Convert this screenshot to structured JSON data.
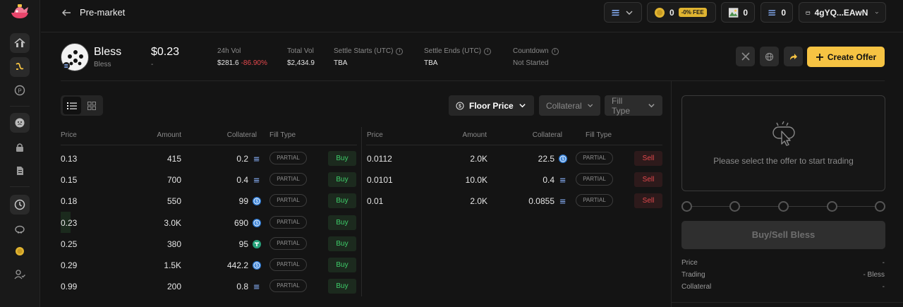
{
  "topbar": {
    "page_title": "Pre-market",
    "points": "0",
    "fee_badge": "-0% FEE",
    "image_count": "0",
    "token_count": "0",
    "wallet": "4gYQ...EAwN"
  },
  "token": {
    "name": "Bless",
    "symbol": "Bless",
    "price": "$0.23",
    "price_change": "-",
    "stats": [
      {
        "label": "24h Vol",
        "value": "$281.6",
        "change": "-86.90%",
        "info": false
      },
      {
        "label": "Total Vol",
        "value": "$2,434.9",
        "change": "",
        "info": false
      },
      {
        "label": "Settle Starts (UTC)",
        "value": "TBA",
        "change": "",
        "info": true
      },
      {
        "label": "Settle Ends (UTC)",
        "value": "TBA",
        "change": "",
        "info": true
      },
      {
        "label": "Countdown",
        "value": "Not Started",
        "change": "",
        "info": true
      }
    ],
    "create_offer_label": "Create Offer"
  },
  "filters": {
    "floor_price": "Floor Price",
    "collateral": "Collateral",
    "fill_type": "Fill Type"
  },
  "table_headers": {
    "price": "Price",
    "amount": "Amount",
    "collateral": "Collateral",
    "fill_type": "Fill Type"
  },
  "buy_orders": [
    {
      "price": "0.13",
      "amount": "415",
      "collateral": "0.2",
      "token": "sol",
      "fill": "PARTIAL",
      "action": "Buy"
    },
    {
      "price": "0.15",
      "amount": "700",
      "collateral": "0.4",
      "token": "sol",
      "fill": "PARTIAL",
      "action": "Buy"
    },
    {
      "price": "0.18",
      "amount": "550",
      "collateral": "99",
      "token": "usdc",
      "fill": "PARTIAL",
      "action": "Buy"
    },
    {
      "price": "0.23",
      "amount": "3.0K",
      "collateral": "690",
      "token": "usdc",
      "fill": "PARTIAL",
      "action": "Buy"
    },
    {
      "price": "0.25",
      "amount": "380",
      "collateral": "95",
      "token": "usdt",
      "fill": "PARTIAL",
      "action": "Buy"
    },
    {
      "price": "0.29",
      "amount": "1.5K",
      "collateral": "442.2",
      "token": "usdc",
      "fill": "PARTIAL",
      "action": "Buy"
    },
    {
      "price": "0.99",
      "amount": "200",
      "collateral": "0.8",
      "token": "sol",
      "fill": "PARTIAL",
      "action": "Buy"
    }
  ],
  "sell_orders": [
    {
      "price": "0.0112",
      "amount": "2.0K",
      "collateral": "22.5",
      "token": "usdc",
      "fill": "PARTIAL",
      "action": "Sell"
    },
    {
      "price": "0.0101",
      "amount": "10.0K",
      "collateral": "0.4",
      "token": "sol",
      "fill": "PARTIAL",
      "action": "Sell"
    },
    {
      "price": "0.01",
      "amount": "2.0K",
      "collateral": "0.0855",
      "token": "sol",
      "fill": "PARTIAL",
      "action": "Sell"
    }
  ],
  "trade_panel": {
    "message": "Please select the offer to start trading",
    "button_label": "Buy/Sell Bless",
    "summary": [
      {
        "label": "Price",
        "value": "-"
      },
      {
        "label": "Trading",
        "value": "- Bless"
      },
      {
        "label": "Collateral",
        "value": "-"
      }
    ]
  },
  "colors": {
    "accent": "#f6c343",
    "buy": "#3ecf6a",
    "sell": "#e5484d",
    "usdc": "#2f7cd6",
    "usdt": "#26a17b"
  }
}
